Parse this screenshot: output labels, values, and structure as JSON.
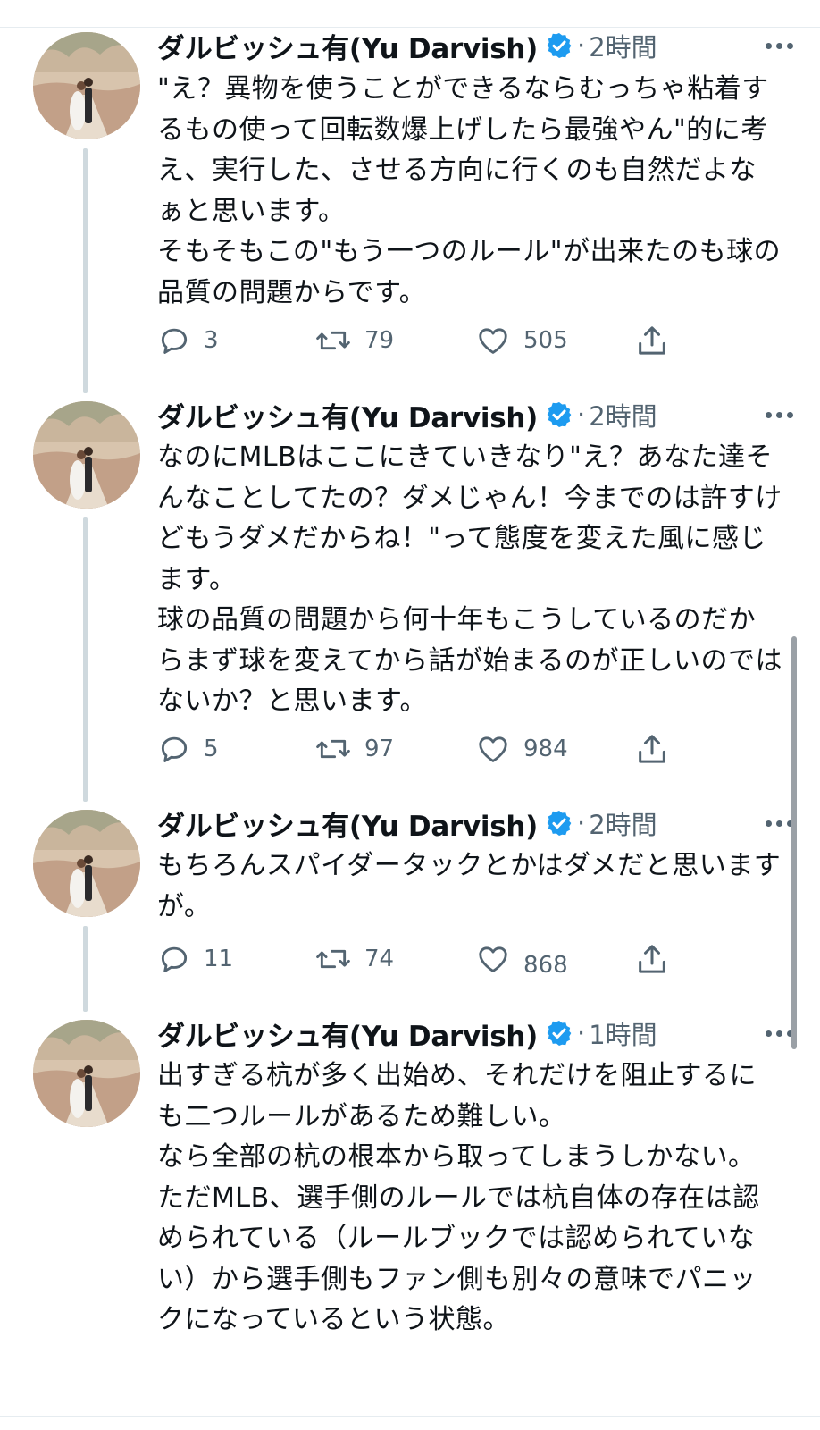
{
  "author": {
    "display_name": "ダルビッシュ有(Yu Darvish)"
  },
  "tweets": [
    {
      "time": "2時間",
      "text": "\"え？異物を使うことができるならむっちゃ粘着するもの使って回転数爆上げしたら最強やん\"的に考え、実行した、させる方向に行くのも自然だよなぁと思います。\nそもそもこの\"もう一つのルール\"が出来たのも球の品質の問題からです。",
      "replies": "3",
      "retweets": "79",
      "likes": "505"
    },
    {
      "time": "2時間",
      "text": "なのにMLBはここにきていきなり\"え？あなた達そんなことしてたの？ダメじゃん！今までのは許すけどもうダメだからね！\"って態度を変えた風に感じます。\n球の品質の問題から何十年もこうしているのだからまず球を変えてから話が始まるのが正しいのではないか？と思います。",
      "replies": "5",
      "retweets": "97",
      "likes": "984"
    },
    {
      "time": "2時間",
      "text": "もちろんスパイダータックとかはダメだと思いますが。",
      "replies": "11",
      "retweets": "74",
      "likes": "868"
    },
    {
      "time": "1時間",
      "text": "出すぎる杭が多く出始め、それだけを阻止するにも二つルールがあるため難しい。\nなら全部の杭の根本から取ってしまうしかない。\nただMLB、選手側のルールでは杭自体の存在は認められている（ルールブックでは認められていない）から選手側もファン側も別々の意味でパニックになっているという状態。"
    }
  ],
  "separator": "·",
  "icons": {
    "avatar": "avatar-wedding-photo",
    "verified": "verified-badge-icon",
    "more": "more-dots-icon",
    "reply": "reply-icon",
    "retweet": "retweet-icon",
    "like": "heart-icon",
    "share": "share-icon"
  },
  "colors": {
    "text": "#0f1419",
    "secondary": "#536471",
    "verified": "#1d9bf0",
    "thread_line": "#cfd9de"
  }
}
